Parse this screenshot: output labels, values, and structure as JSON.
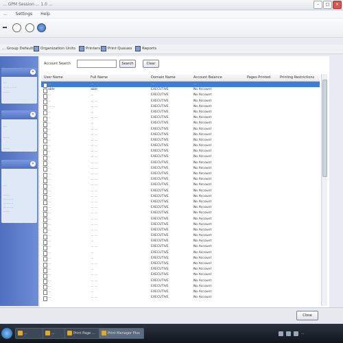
{
  "window": {
    "title": "... GPM Session ... 1.0 ..."
  },
  "menu": [
    "...",
    "Settings",
    "Help"
  ],
  "tabs": [
    "... Group Defaults",
    "Organization Units",
    "Printers",
    "Print Queues",
    "Reports"
  ],
  "sidebar": {
    "panel1_lines": [
      "...",
      "... ... ... ...",
      "... ..."
    ],
    "panel2_lines": [
      "...",
      "... ...",
      "... ..."
    ],
    "panel3_lines": [
      "...",
      "... ...",
      "... ... ...",
      "... ... ...",
      "... ... ...",
      "... ..."
    ]
  },
  "search": {
    "label": "Account Search",
    "value": "",
    "search_button": "Search",
    "clear_button": "Clear"
  },
  "columns": [
    "User Name",
    "Full Name",
    "Domain Name",
    "Account Balance",
    "Pages Printed",
    "Printing Restrictions"
  ],
  "rows": [
    [
      "...",
      "...",
      "...",
      "..."
    ],
    [
      "able",
      "able",
      "EXECUTIVE",
      "No Account"
    ],
    [
      "...",
      "...",
      "EXECUTIVE",
      "No Account"
    ],
    [
      "...",
      "... ...",
      "EXECUTIVE",
      "No Account"
    ],
    [
      "... ...",
      "... ...",
      "EXECUTIVE",
      "No Account"
    ],
    [
      "...",
      "...",
      "EXECUTIVE",
      "No Account"
    ],
    [
      "...",
      "... ...",
      "EXECUTIVE",
      "No Account"
    ],
    [
      "...",
      "...",
      "EXECUTIVE",
      "No Account"
    ],
    [
      "...",
      "... ...",
      "EXECUTIVE",
      "No Account"
    ],
    [
      "...",
      "... ...",
      "EXECUTIVE",
      "No Account"
    ],
    [
      "...",
      "... ...",
      "EXECUTIVE",
      "No Account"
    ],
    [
      "...",
      "... ...",
      "EXECUTIVE",
      "No Account"
    ],
    [
      "...",
      "... ...",
      "EXECUTIVE",
      "No Account"
    ],
    [
      "...",
      "... ...",
      "EXECUTIVE",
      "No Account"
    ],
    [
      "...",
      "... ...",
      "EXECUTIVE",
      "No Account"
    ],
    [
      "...",
      "... ...",
      "EXECUTIVE",
      "No Account"
    ],
    [
      "...",
      "... ...",
      "EXECUTIVE",
      "No Account"
    ],
    [
      "...",
      "... ...",
      "EXECUTIVE",
      "No Account"
    ],
    [
      "...",
      "... ...",
      "EXECUTIVE",
      "No Account"
    ],
    [
      "...",
      "... ...",
      "EXECUTIVE",
      "No Account"
    ],
    [
      "...",
      "... ...",
      "EXECUTIVE",
      "No Account"
    ],
    [
      "...",
      "... ...",
      "EXECUTIVE",
      "No Account"
    ],
    [
      "...",
      "... ...",
      "EXECUTIVE",
      "No Account"
    ],
    [
      "...",
      "... ...",
      "EXECUTIVE",
      "No Account"
    ],
    [
      "...",
      "... ...",
      "EXECUTIVE",
      "No Account"
    ],
    [
      "...",
      "... ...",
      "EXECUTIVE",
      "No Account"
    ],
    [
      "...",
      "... ...",
      "EXECUTIVE",
      "No Account"
    ],
    [
      "...",
      "... ...",
      "EXECUTIVE",
      "No Account"
    ],
    [
      "...",
      "...",
      "EXECUTIVE",
      "No Account"
    ],
    [
      "...",
      "... ...",
      "EXECUTIVE",
      "No Account"
    ],
    [
      "...",
      "...",
      "EXECUTIVE",
      "No Account"
    ],
    [
      "...",
      "...",
      "EXECUTIVE",
      "No Account"
    ],
    [
      "...",
      "... ...",
      "EXECUTIVE",
      "No Account"
    ],
    [
      "...",
      "...",
      "EXECUTIVE",
      "No Account"
    ],
    [
      "...",
      "... ...",
      "EXECUTIVE",
      "No Account"
    ],
    [
      "...",
      "... ...",
      "EXECUTIVE",
      "No Account"
    ],
    [
      "...",
      "... ...",
      "EXECUTIVE",
      "No Account"
    ],
    [
      "...",
      "...",
      "EXECUTIVE",
      "No Account"
    ],
    [
      "...",
      "... ...",
      "EXECUTIVE",
      "No Account"
    ]
  ],
  "footer": {
    "close_button": "Close"
  },
  "taskbar": {
    "tasks": [
      "...",
      "...",
      "Print Page ...",
      "Print Manager Plus"
    ],
    "clock": "..."
  },
  "colors": {
    "selection": "#3b7ddb",
    "sidebar": "#5a79c8"
  }
}
